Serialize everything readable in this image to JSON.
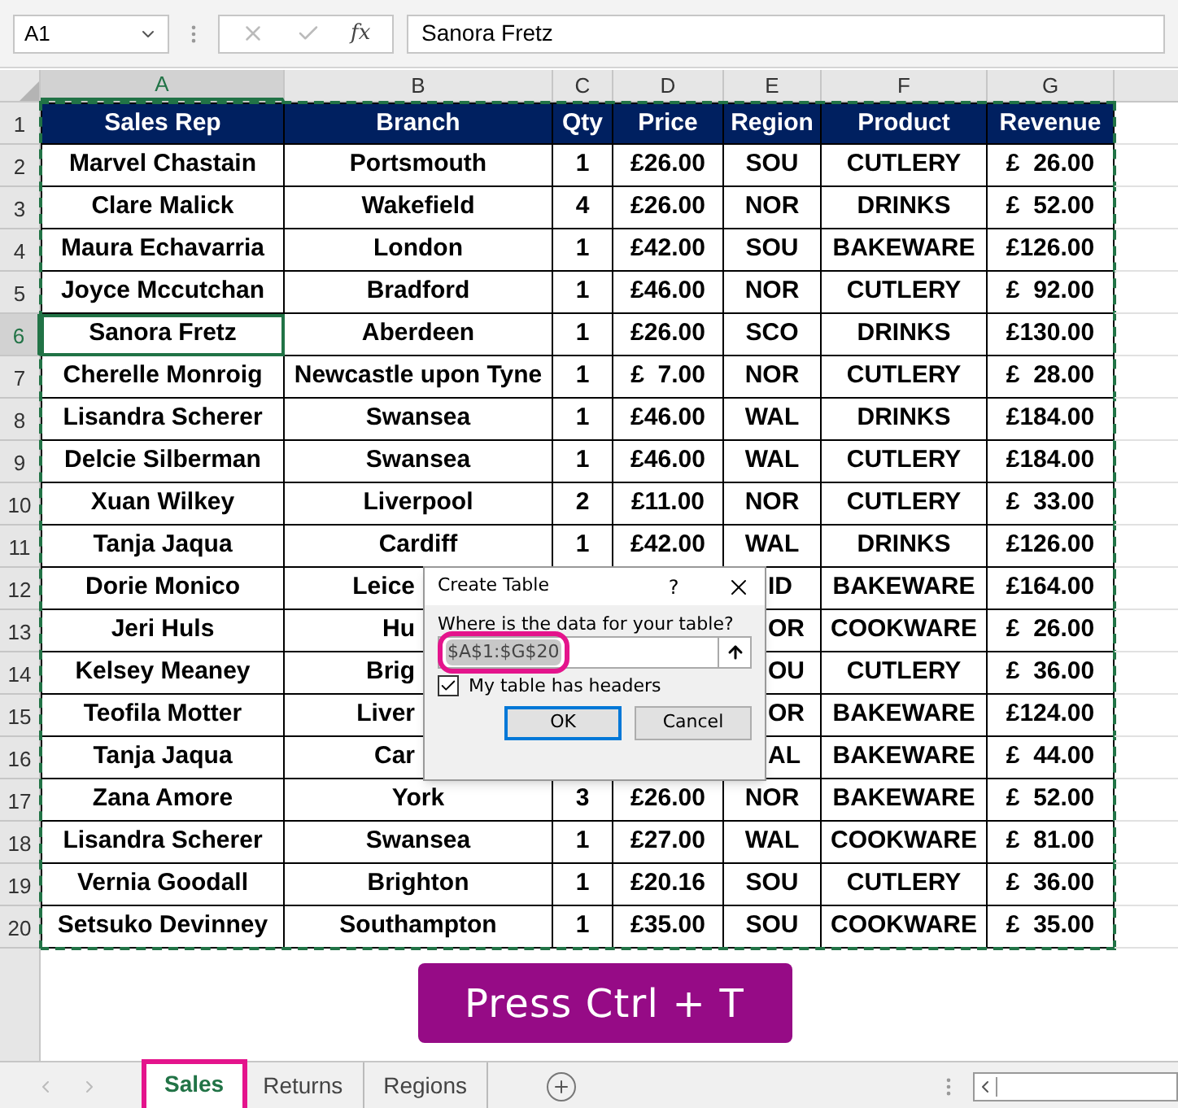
{
  "name_box": "A1",
  "formula_bar": {
    "fx": "fx",
    "value": "Sanora Fretz"
  },
  "columns": [
    {
      "label": "A",
      "selected": true
    },
    {
      "label": "B",
      "selected": false
    },
    {
      "label": "C",
      "selected": false
    },
    {
      "label": "D",
      "selected": false
    },
    {
      "label": "E",
      "selected": false
    },
    {
      "label": "F",
      "selected": false
    },
    {
      "label": "G",
      "selected": false
    }
  ],
  "rows": [
    {
      "number": "1",
      "kind": "header",
      "selected": false,
      "under_dialog": false,
      "cells": [
        "Sales Rep",
        "Branch",
        "Qty",
        "Price",
        "Region",
        "Product",
        "Revenue"
      ]
    },
    {
      "number": "2",
      "kind": "data",
      "selected": false,
      "under_dialog": false,
      "cells": [
        "Marvel Chastain",
        "Portsmouth",
        "1",
        "£26.00",
        "SOU",
        "CUTLERY",
        "£  26.00"
      ]
    },
    {
      "number": "3",
      "kind": "data",
      "selected": false,
      "under_dialog": false,
      "cells": [
        "Clare Malick",
        "Wakefield",
        "4",
        "£26.00",
        "NOR",
        "DRINKS",
        "£  52.00"
      ]
    },
    {
      "number": "4",
      "kind": "data",
      "selected": false,
      "under_dialog": false,
      "cells": [
        "Maura Echavarria",
        "London",
        "1",
        "£42.00",
        "SOU",
        "BAKEWARE",
        "£126.00"
      ]
    },
    {
      "number": "5",
      "kind": "data",
      "selected": false,
      "under_dialog": false,
      "cells": [
        "Joyce Mccutchan",
        "Bradford",
        "1",
        "£46.00",
        "NOR",
        "CUTLERY",
        "£  92.00"
      ]
    },
    {
      "number": "6",
      "kind": "data",
      "selected": true,
      "under_dialog": false,
      "cells": [
        "Sanora Fretz",
        "Aberdeen",
        "1",
        "£26.00",
        "SCO",
        "DRINKS",
        "£130.00"
      ]
    },
    {
      "number": "7",
      "kind": "data",
      "selected": false,
      "under_dialog": false,
      "cells": [
        "Cherelle Monroig",
        "Newcastle upon Tyne",
        "1",
        "£  7.00",
        "NOR",
        "CUTLERY",
        "£  28.00"
      ]
    },
    {
      "number": "8",
      "kind": "data",
      "selected": false,
      "under_dialog": false,
      "cells": [
        "Lisandra Scherer",
        "Swansea",
        "1",
        "£46.00",
        "WAL",
        "DRINKS",
        "£184.00"
      ]
    },
    {
      "number": "9",
      "kind": "data",
      "selected": false,
      "under_dialog": false,
      "cells": [
        "Delcie Silberman",
        "Swansea",
        "1",
        "£46.00",
        "WAL",
        "CUTLERY",
        "£184.00"
      ]
    },
    {
      "number": "10",
      "kind": "data",
      "selected": false,
      "under_dialog": false,
      "cells": [
        "Xuan Wilkey",
        "Liverpool",
        "2",
        "£11.00",
        "NOR",
        "CUTLERY",
        "£  33.00"
      ]
    },
    {
      "number": "11",
      "kind": "data",
      "selected": false,
      "under_dialog": false,
      "cells": [
        "Tanja Jaqua",
        "Cardiff",
        "1",
        "£42.00",
        "WAL",
        "DRINKS",
        "£126.00"
      ]
    },
    {
      "number": "12",
      "kind": "data",
      "selected": false,
      "under_dialog": true,
      "cells": [
        "Dorie Monico",
        "Leice",
        null,
        null,
        "ID",
        "BAKEWARE",
        "£164.00"
      ]
    },
    {
      "number": "13",
      "kind": "data",
      "selected": false,
      "under_dialog": true,
      "cells": [
        "Jeri Huls",
        "Hu",
        null,
        null,
        "OR",
        "COOKWARE",
        "£  26.00"
      ]
    },
    {
      "number": "14",
      "kind": "data",
      "selected": false,
      "under_dialog": true,
      "cells": [
        "Kelsey Meaney",
        "Brig",
        null,
        null,
        "OU",
        "CUTLERY",
        "£  36.00"
      ]
    },
    {
      "number": "15",
      "kind": "data",
      "selected": false,
      "under_dialog": true,
      "cells": [
        "Teofila Motter",
        "Liver",
        null,
        null,
        "OR",
        "BAKEWARE",
        "£124.00"
      ]
    },
    {
      "number": "16",
      "kind": "data",
      "selected": false,
      "under_dialog": true,
      "cells": [
        "Tanja Jaqua",
        "Car",
        null,
        null,
        "AL",
        "BAKEWARE",
        "£  44.00"
      ]
    },
    {
      "number": "17",
      "kind": "data",
      "selected": false,
      "under_dialog": false,
      "cells": [
        "Zana Amore",
        "York",
        "3",
        "£26.00",
        "NOR",
        "BAKEWARE",
        "£  52.00"
      ]
    },
    {
      "number": "18",
      "kind": "data",
      "selected": false,
      "under_dialog": false,
      "cells": [
        "Lisandra Scherer",
        "Swansea",
        "1",
        "£27.00",
        "WAL",
        "COOKWARE",
        "£  81.00"
      ]
    },
    {
      "number": "19",
      "kind": "data",
      "selected": false,
      "under_dialog": false,
      "cells": [
        "Vernia Goodall",
        "Brighton",
        "1",
        "£20.16",
        "SOU",
        "CUTLERY",
        "£  36.00"
      ]
    },
    {
      "number": "20",
      "kind": "data",
      "selected": false,
      "under_dialog": false,
      "cells": [
        "Setsuko Devinney",
        "Southampton",
        "1",
        "£35.00",
        "SOU",
        "COOKWARE",
        "£  35.00"
      ]
    }
  ],
  "dialog": {
    "title": "Create Table",
    "help": "?",
    "prompt": "Where is the data for your table?",
    "range": {
      "value": "$A$1:$G$20",
      "highlighted": true
    },
    "headers_checkbox": {
      "label": "My table has headers",
      "checked": true
    },
    "buttons": [
      {
        "label": "OK",
        "kind": "default"
      },
      {
        "label": "Cancel",
        "kind": "normal"
      }
    ]
  },
  "banner": "Press Ctrl + T",
  "sheet_tabs": [
    {
      "label": "Sales",
      "selected": true,
      "highlighted": true
    },
    {
      "label": "Returns",
      "selected": false,
      "highlighted": false
    },
    {
      "label": "Regions",
      "selected": false,
      "highlighted": false
    }
  ]
}
